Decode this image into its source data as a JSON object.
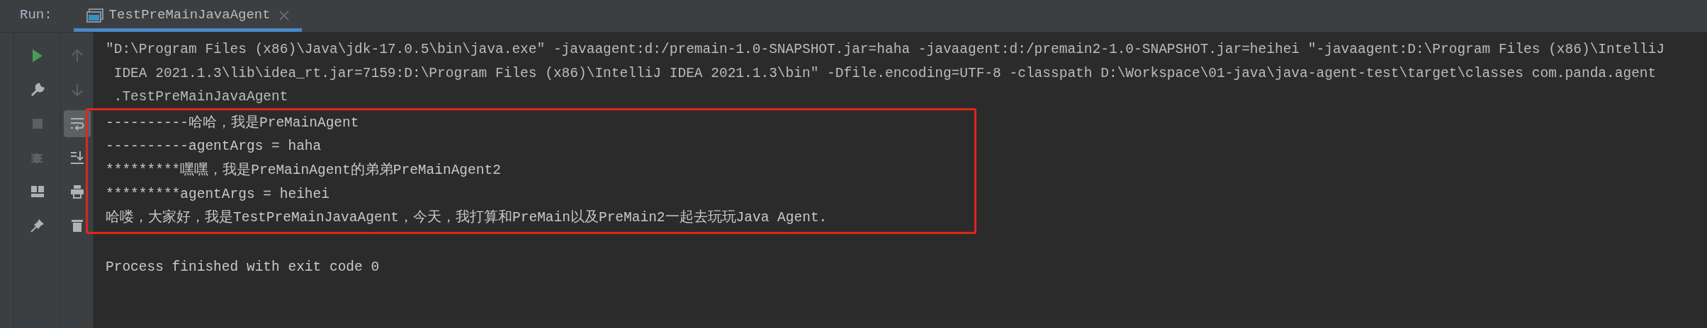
{
  "run_bar": {
    "label": "Run:",
    "tabs": [
      {
        "label": "TestPreMainJavaAgent",
        "selected": true
      }
    ]
  },
  "left_toolbar": [
    {
      "kind": "rerun",
      "disabled": false
    },
    {
      "kind": "wrench",
      "disabled": false
    },
    {
      "kind": "stop",
      "disabled": true
    },
    {
      "kind": "bug",
      "disabled": true
    },
    {
      "kind": "layout",
      "disabled": false
    },
    {
      "kind": "pin",
      "disabled": false
    }
  ],
  "console_toolbar": [
    {
      "kind": "up",
      "disabled": true,
      "selected": false
    },
    {
      "kind": "down",
      "disabled": true,
      "selected": false
    },
    {
      "kind": "wrap",
      "disabled": false,
      "selected": true
    },
    {
      "kind": "scroll-end",
      "disabled": false,
      "selected": false
    },
    {
      "kind": "print",
      "disabled": false,
      "selected": false
    },
    {
      "kind": "trash",
      "disabled": false,
      "selected": false
    }
  ],
  "console": {
    "lines": [
      {
        "kind": "command",
        "highlighted": false,
        "text": "\"D:\\Program Files (x86)\\Java\\jdk-17.0.5\\bin\\java.exe\" -javaagent:d:/premain-1.0-SNAPSHOT.jar=haha -javaagent:d:/premain2-1.0-SNAPSHOT.jar=heihei \"-javaagent:D:\\Program Files (x86)\\IntelliJ"
      },
      {
        "kind": "command",
        "highlighted": false,
        "text": " IDEA 2021.1.3\\lib\\idea_rt.jar=7159:D:\\Program Files (x86)\\IntelliJ IDEA 2021.1.3\\bin\" -Dfile.encoding=UTF-8 -classpath D:\\Workspace\\01-java\\java-agent-test\\target\\classes com.panda.agent"
      },
      {
        "kind": "command",
        "highlighted": false,
        "text": " .TestPreMainJavaAgent"
      },
      {
        "kind": "output",
        "highlighted": true,
        "text": "----------哈哈，我是PreMainAgent"
      },
      {
        "kind": "output",
        "highlighted": true,
        "text": "----------agentArgs = haha"
      },
      {
        "kind": "output",
        "highlighted": true,
        "text": "*********嘿嘿，我是PreMainAgent的弟弟PreMainAgent2"
      },
      {
        "kind": "output",
        "highlighted": true,
        "text": "*********agentArgs = heihei"
      },
      {
        "kind": "output",
        "highlighted": true,
        "text": "哈喽，大家好，我是TestPreMainJavaAgent，今天，我打算和PreMain以及PreMain2一起去玩玩Java Agent."
      },
      {
        "kind": "exit",
        "highlighted": false,
        "text": "Process finished with exit code 0"
      }
    ]
  }
}
